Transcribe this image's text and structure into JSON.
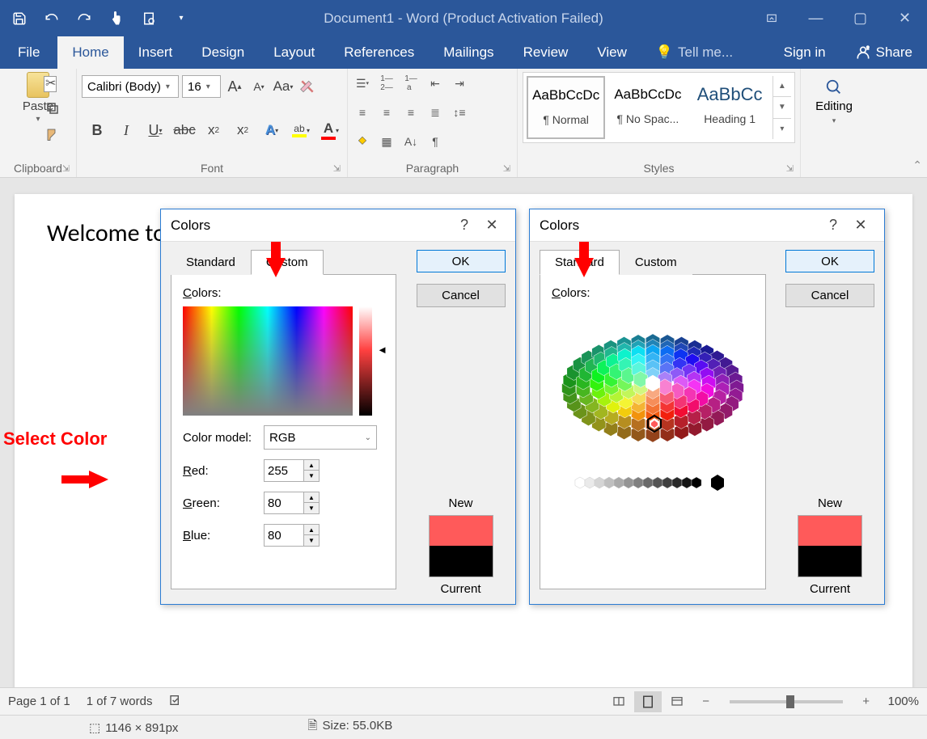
{
  "titlebar": {
    "title": "Document1 - Word (Product Activation Failed)"
  },
  "tabs": {
    "file": "File",
    "home": "Home",
    "insert": "Insert",
    "design": "Design",
    "layout": "Layout",
    "references": "References",
    "mailings": "Mailings",
    "review": "Review",
    "view": "View",
    "tellme": "Tell me...",
    "signin": "Sign in",
    "share": "Share"
  },
  "ribbon": {
    "clipboard": {
      "label": "Clipboard",
      "paste": "Paste"
    },
    "font": {
      "label": "Font",
      "name": "Calibri (Body)",
      "size": "16",
      "case": "Aa"
    },
    "paragraph": {
      "label": "Paragraph"
    },
    "styles": {
      "label": "Styles",
      "sample": "AaBbCcDc",
      "sample_h1": "AaBbCc",
      "s1": "¶ Normal",
      "s2": "¶ No Spac...",
      "s3": "Heading 1"
    },
    "editing": {
      "label": "Editing"
    }
  },
  "document": {
    "text": "Welcome to",
    "annotation": "Select Color"
  },
  "dialog": {
    "title": "Colors",
    "ok": "OK",
    "cancel": "Cancel",
    "tab_standard": "Standard",
    "tab_custom": "Custom",
    "colors_label": "Colors:",
    "color_model_label": "Color model:",
    "color_model_value": "RGB",
    "red_label": "Red:",
    "green_label": "Green:",
    "blue_label": "Blue:",
    "red_value": "255",
    "green_value": "80",
    "blue_value": "80",
    "new_label": "New",
    "current_label": "Current",
    "new_color": "#ff5a5a",
    "current_color": "#000000"
  },
  "statusbar": {
    "page": "Page 1 of 1",
    "words": "1 of 7 words",
    "zoom": "100%"
  },
  "photoinfo": {
    "dims": "1146 × 891px",
    "size": "Size: 55.0KB"
  }
}
